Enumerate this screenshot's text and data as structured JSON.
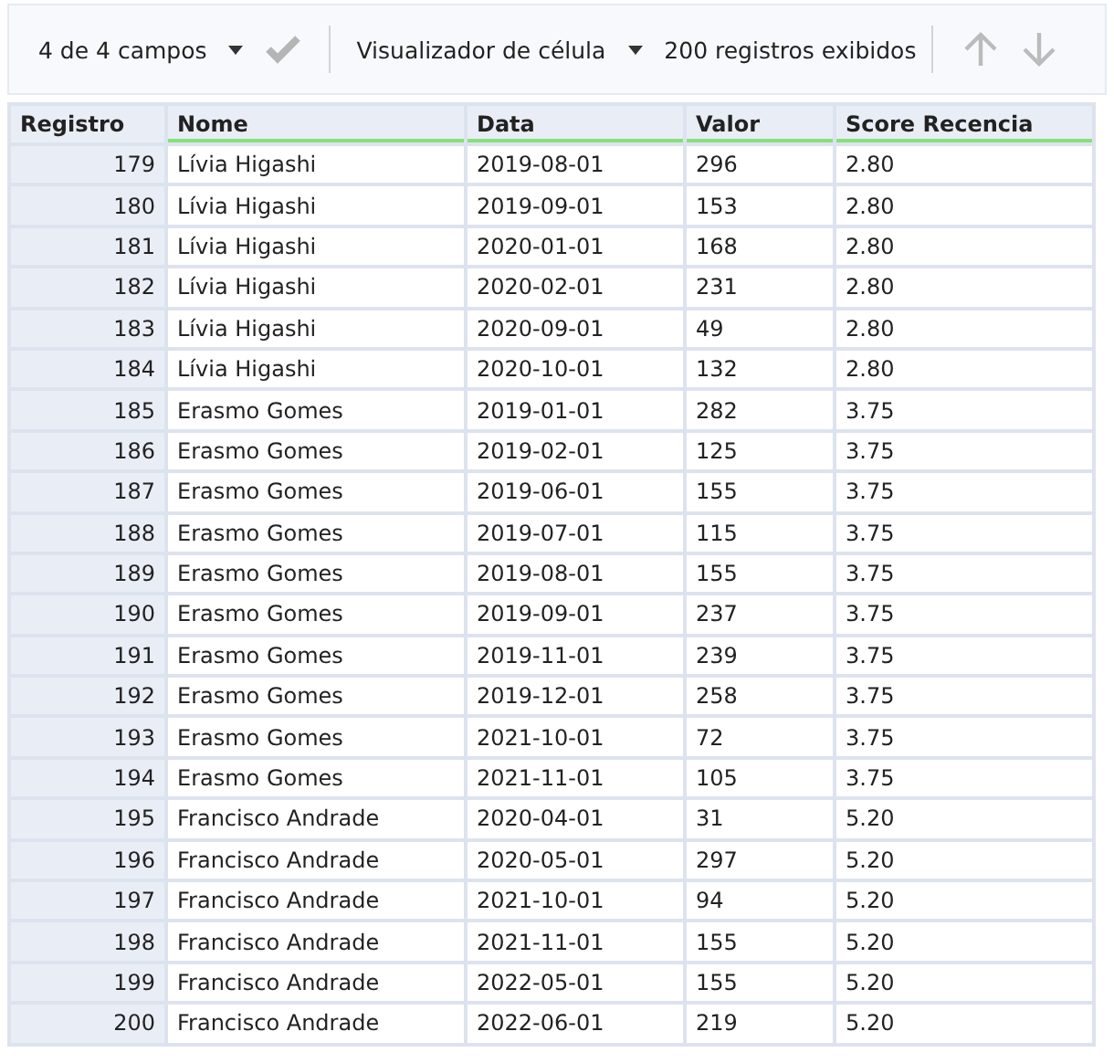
{
  "toolbar": {
    "fields_dropdown": "4 de 4 campos",
    "viewer_dropdown": "Visualizador de célula",
    "record_count": "200 registros exibidos"
  },
  "table": {
    "columns": [
      {
        "label": "Registro",
        "kind": "index"
      },
      {
        "label": "Nome",
        "kind": "data"
      },
      {
        "label": "Data",
        "kind": "data"
      },
      {
        "label": "Valor",
        "kind": "data"
      },
      {
        "label": "Score Recencia",
        "kind": "data"
      }
    ],
    "rows": [
      [
        "179",
        "Lívia Higashi",
        "2019-08-01",
        "296",
        "2.80"
      ],
      [
        "180",
        "Lívia Higashi",
        "2019-09-01",
        "153",
        "2.80"
      ],
      [
        "181",
        "Lívia Higashi",
        "2020-01-01",
        "168",
        "2.80"
      ],
      [
        "182",
        "Lívia Higashi",
        "2020-02-01",
        "231",
        "2.80"
      ],
      [
        "183",
        "Lívia Higashi",
        "2020-09-01",
        "49",
        "2.80"
      ],
      [
        "184",
        "Lívia Higashi",
        "2020-10-01",
        "132",
        "2.80"
      ],
      [
        "185",
        "Erasmo Gomes",
        "2019-01-01",
        "282",
        "3.75"
      ],
      [
        "186",
        "Erasmo Gomes",
        "2019-02-01",
        "125",
        "3.75"
      ],
      [
        "187",
        "Erasmo Gomes",
        "2019-06-01",
        "155",
        "3.75"
      ],
      [
        "188",
        "Erasmo Gomes",
        "2019-07-01",
        "115",
        "3.75"
      ],
      [
        "189",
        "Erasmo Gomes",
        "2019-08-01",
        "155",
        "3.75"
      ],
      [
        "190",
        "Erasmo Gomes",
        "2019-09-01",
        "237",
        "3.75"
      ],
      [
        "191",
        "Erasmo Gomes",
        "2019-11-01",
        "239",
        "3.75"
      ],
      [
        "192",
        "Erasmo Gomes",
        "2019-12-01",
        "258",
        "3.75"
      ],
      [
        "193",
        "Erasmo Gomes",
        "2021-10-01",
        "72",
        "3.75"
      ],
      [
        "194",
        "Erasmo Gomes",
        "2021-11-01",
        "105",
        "3.75"
      ],
      [
        "195",
        "Francisco Andrade",
        "2020-04-01",
        "31",
        "5.20"
      ],
      [
        "196",
        "Francisco Andrade",
        "2020-05-01",
        "297",
        "5.20"
      ],
      [
        "197",
        "Francisco Andrade",
        "2021-10-01",
        "94",
        "5.20"
      ],
      [
        "198",
        "Francisco Andrade",
        "2021-11-01",
        "155",
        "5.20"
      ],
      [
        "199",
        "Francisco Andrade",
        "2022-05-01",
        "155",
        "5.20"
      ],
      [
        "200",
        "Francisco Andrade",
        "2022-06-01",
        "219",
        "5.20"
      ]
    ]
  }
}
